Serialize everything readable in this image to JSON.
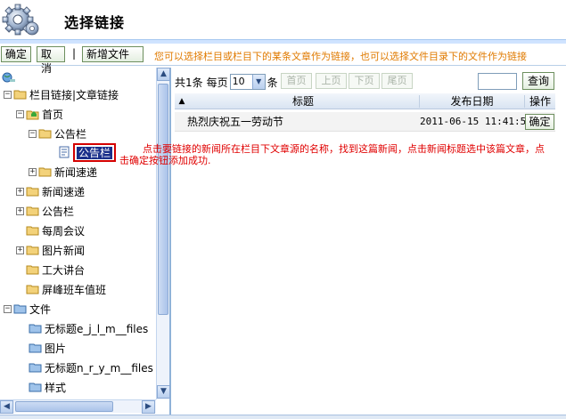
{
  "header": {
    "title": "选择链接"
  },
  "toolbar": {
    "confirm_label": "确定",
    "cancel_label": "取消",
    "separator": "|",
    "new_file_label": "新增文件",
    "hint": "您可以选择栏目或栏目下的某条文章作为链接，也可以选择文件目录下的文件作为链接"
  },
  "tree": {
    "root_label": "栏目链接|文章链接",
    "items": [
      {
        "label": "首页"
      },
      {
        "label": "公告栏"
      },
      {
        "label": "公告栏"
      },
      {
        "label": "新闻速递"
      },
      {
        "label": "新闻速递"
      },
      {
        "label": "公告栏"
      },
      {
        "label": "每周会议"
      },
      {
        "label": "图片新闻"
      },
      {
        "label": "工大讲台"
      },
      {
        "label": "屏峰班车值班"
      }
    ],
    "files_label": "文件",
    "files": [
      {
        "label": "无标题e_j_l_m__files"
      },
      {
        "label": "图片"
      },
      {
        "label": "无标题n_r_y_m__files"
      },
      {
        "label": "样式"
      }
    ]
  },
  "pager": {
    "total_prefix": "共1条",
    "per_page_label": "每页",
    "per_page_value": "10",
    "unit": "条",
    "first": "首页",
    "prev": "上页",
    "next": "下页",
    "last": "尾页",
    "search_label": "查询"
  },
  "grid": {
    "sort_indicator": "▲",
    "headers": {
      "title": "标题",
      "date": "发布日期",
      "action": "操作"
    },
    "rows": [
      {
        "title": "热烈庆祝五一劳动节",
        "date": "2011-06-15 11:41:56",
        "action": "确定"
      }
    ]
  },
  "note": {
    "line1": "点击要链接的新闻所在栏目下文章源的名称，找到这篇新闻，点击新闻标题选中该篇文章，点",
    "line2": "击确定按钮添加成功."
  },
  "colors": {
    "hint": "#e07a00",
    "note": "#e00000",
    "selection": "#1a2f8a",
    "highlight_border": "#d40000"
  }
}
